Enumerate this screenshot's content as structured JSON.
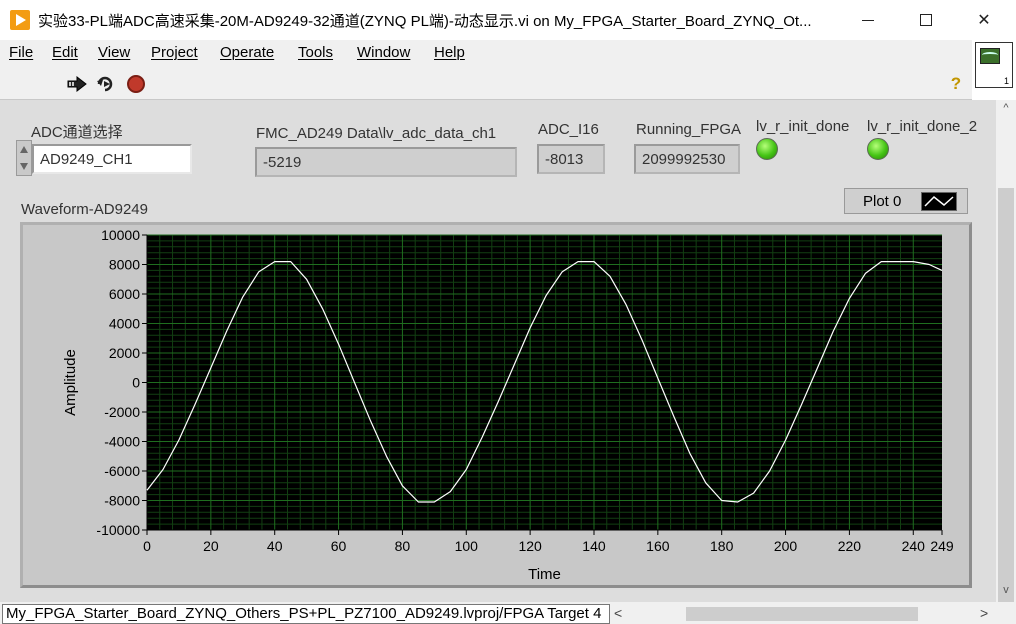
{
  "window": {
    "title": "实验33-PL端ADC高速采集-20M-AD9249-32通道(ZYNQ PL端)-动态显示.vi on My_FPGA_Starter_Board_ZYNQ_Ot...",
    "close_glyph": "✕"
  },
  "menu": [
    {
      "label": "File"
    },
    {
      "label": "Edit"
    },
    {
      "label": "View"
    },
    {
      "label": "Project"
    },
    {
      "label": "Operate"
    },
    {
      "label": "Tools"
    },
    {
      "label": "Window"
    },
    {
      "label": "Help"
    }
  ],
  "toolbar": {
    "run_icon": "run-arrow-icon",
    "run_continuously_icon": "run-continuously-icon",
    "abort_icon": "abort-stop-icon",
    "help_icon": "context-help-icon",
    "help_glyph": "?"
  },
  "vi_icon": {
    "label": "1"
  },
  "controls": {
    "channel_select": {
      "label": "ADC通道选择",
      "value": "AD9249_CH1"
    },
    "adc_data": {
      "label": "FMC_AD249 Data\\lv_adc_data_ch1",
      "value": "-5219"
    },
    "adc_i16": {
      "label": "ADC_I16",
      "value": "-8013"
    },
    "running_fpga": {
      "label": "Running_FPGA",
      "value": "2099992530"
    },
    "init_done": {
      "label": "lv_r_init_done",
      "state": "on"
    },
    "init_done_2": {
      "label": "lv_r_init_done_2",
      "state": "on"
    }
  },
  "graph": {
    "label": "Waveform-AD9249",
    "legend": "Plot 0"
  },
  "chart_data": {
    "type": "line",
    "title": "Waveform-AD9249",
    "xlabel": "Time",
    "ylabel": "Amplitude",
    "xlim": [
      0,
      249
    ],
    "ylim": [
      -10000,
      10000
    ],
    "x_ticks": [
      0,
      20,
      40,
      60,
      80,
      100,
      120,
      140,
      160,
      180,
      200,
      220,
      240,
      249
    ],
    "y_ticks": [
      10000,
      8000,
      6000,
      4000,
      2000,
      0,
      -2000,
      -4000,
      -6000,
      -8000,
      -10000
    ],
    "grid": true,
    "legend_position": "top-right",
    "colors": {
      "plot_bg": "#000000",
      "grid": "#1f6e1f",
      "line": "#ffffff"
    },
    "series": [
      {
        "name": "Plot 0",
        "x": [
          0,
          5,
          10,
          15,
          20,
          25,
          30,
          35,
          40,
          45,
          50,
          55,
          60,
          65,
          70,
          75,
          80,
          85,
          90,
          95,
          100,
          105,
          110,
          115,
          120,
          125,
          130,
          135,
          140,
          145,
          150,
          155,
          160,
          165,
          170,
          175,
          180,
          185,
          190,
          195,
          200,
          205,
          210,
          215,
          220,
          225,
          230,
          235,
          240,
          245,
          249
        ],
        "y": [
          -7300,
          -5900,
          -3900,
          -1500,
          1000,
          3500,
          5800,
          7500,
          8200,
          8200,
          7000,
          5000,
          2600,
          0,
          -2600,
          -5000,
          -7000,
          -8100,
          -8100,
          -7400,
          -5900,
          -3700,
          -1300,
          1200,
          3700,
          5900,
          7500,
          8200,
          8200,
          7200,
          5300,
          2900,
          300,
          -2300,
          -4800,
          -6800,
          -8000,
          -8100,
          -7500,
          -6000,
          -3900,
          -1500,
          1000,
          3500,
          5700,
          7400,
          8200,
          8200,
          8200,
          8000,
          7600
        ]
      }
    ]
  },
  "status": {
    "path": "My_FPGA_Starter_Board_ZYNQ_Others_PS+PL_PZ7100_AD9249.lvproj/FPGA Target 4",
    "scroll_left": "<",
    "scroll_right": ">"
  },
  "scroll": {
    "up": "^",
    "down": "v"
  }
}
